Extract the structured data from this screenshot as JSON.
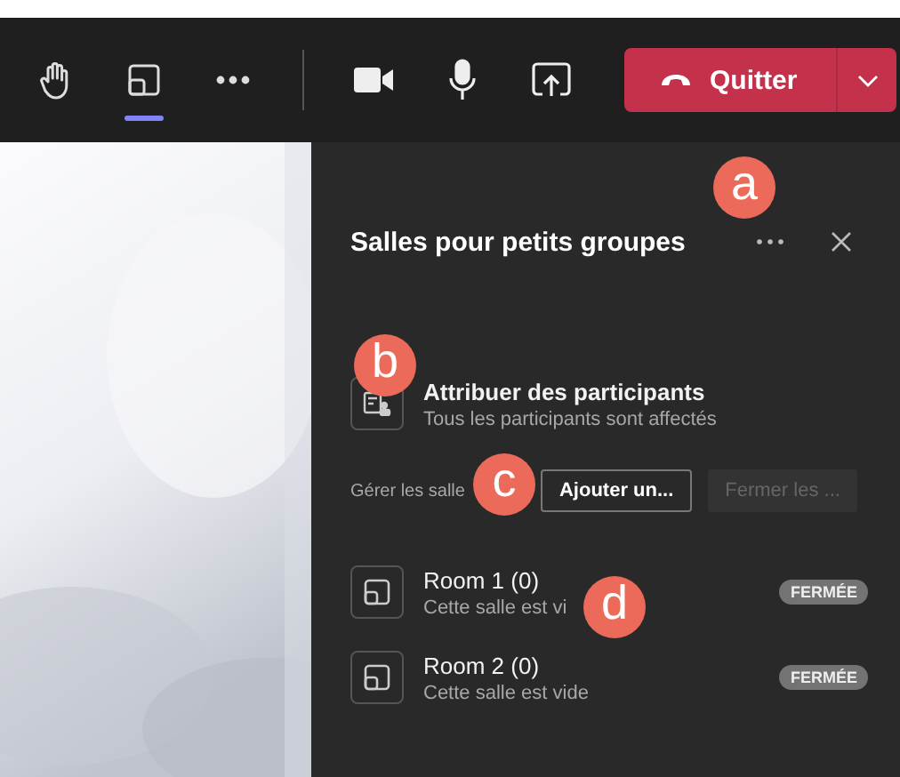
{
  "toolbar": {
    "left_buttons": [
      {
        "kind": "hand",
        "selected": false
      },
      {
        "kind": "rooms",
        "selected": true
      },
      {
        "kind": "more",
        "selected": false
      }
    ],
    "media_buttons": [
      {
        "kind": "camera"
      },
      {
        "kind": "mic"
      },
      {
        "kind": "share"
      }
    ],
    "leave_button": {
      "label": "Quitter"
    }
  },
  "panel": {
    "title": "Salles pour petits groupes",
    "assign": {
      "title": "Attribuer des participants",
      "subtitle": "Tous les participants sont affectés"
    },
    "manage": {
      "label": "Gérer les salle",
      "buttons": [
        {
          "label": "Ajouter un...",
          "disabled": false
        },
        {
          "label": "Fermer les ...",
          "disabled": true
        }
      ]
    },
    "rooms": [
      {
        "name": "Room 1 (0)",
        "subtitle": "Cette salle est vi",
        "badge": "FERMÉE"
      },
      {
        "name": "Room 2 (0)",
        "subtitle": "Cette salle est vide",
        "badge": "FERMÉE"
      }
    ]
  },
  "callouts": [
    {
      "label": "a"
    },
    {
      "label": "b"
    },
    {
      "label": "c"
    },
    {
      "label": "d"
    }
  ]
}
